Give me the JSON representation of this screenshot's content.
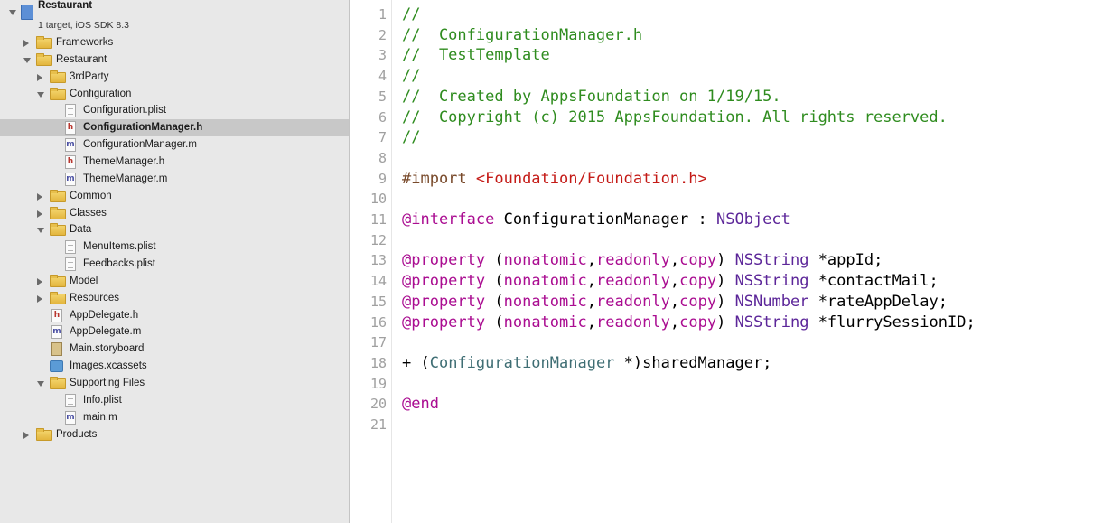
{
  "navigator": {
    "project": {
      "name": "Restaurant",
      "subtitle": "1 target, iOS SDK 8.3"
    },
    "items": [
      {
        "label": "Frameworks",
        "kind": "folder",
        "disclosure": "collapsed",
        "depth": 1
      },
      {
        "label": "Restaurant",
        "kind": "folder",
        "disclosure": "expanded",
        "depth": 1
      },
      {
        "label": "3rdParty",
        "kind": "folder",
        "disclosure": "collapsed",
        "depth": 2
      },
      {
        "label": "Configuration",
        "kind": "folder",
        "disclosure": "expanded",
        "depth": 2
      },
      {
        "label": "Configuration.plist",
        "kind": "plist",
        "depth": 3
      },
      {
        "label": "ConfigurationManager.h",
        "kind": "h",
        "depth": 3,
        "selected": true
      },
      {
        "label": "ConfigurationManager.m",
        "kind": "m",
        "depth": 3
      },
      {
        "label": "ThemeManager.h",
        "kind": "h",
        "depth": 3
      },
      {
        "label": "ThemeManager.m",
        "kind": "m",
        "depth": 3
      },
      {
        "label": "Common",
        "kind": "folder",
        "disclosure": "collapsed",
        "depth": 2
      },
      {
        "label": "Classes",
        "kind": "folder",
        "disclosure": "collapsed",
        "depth": 2
      },
      {
        "label": "Data",
        "kind": "folder",
        "disclosure": "expanded",
        "depth": 2
      },
      {
        "label": "MenuItems.plist",
        "kind": "plist",
        "depth": 3
      },
      {
        "label": "Feedbacks.plist",
        "kind": "plist",
        "depth": 3
      },
      {
        "label": "Model",
        "kind": "folder",
        "disclosure": "collapsed",
        "depth": 2
      },
      {
        "label": "Resources",
        "kind": "folder",
        "disclosure": "collapsed",
        "depth": 2
      },
      {
        "label": "AppDelegate.h",
        "kind": "h",
        "depth": 2
      },
      {
        "label": "AppDelegate.m",
        "kind": "m",
        "depth": 2
      },
      {
        "label": "Main.storyboard",
        "kind": "storyboard",
        "depth": 2
      },
      {
        "label": "Images.xcassets",
        "kind": "xcassets",
        "depth": 2
      },
      {
        "label": "Supporting Files",
        "kind": "folder",
        "disclosure": "expanded",
        "depth": 2
      },
      {
        "label": "Info.plist",
        "kind": "plist",
        "depth": 3
      },
      {
        "label": "main.m",
        "kind": "m",
        "depth": 3
      },
      {
        "label": "Products",
        "kind": "folder",
        "disclosure": "collapsed",
        "depth": 1
      }
    ]
  },
  "icons": {
    "h_glyph": "h",
    "m_glyph": "m"
  },
  "editor": {
    "lines": [
      {
        "n": "1",
        "tokens": [
          {
            "t": "//",
            "c": "comment"
          }
        ]
      },
      {
        "n": "2",
        "tokens": [
          {
            "t": "//  ConfigurationManager.h",
            "c": "comment"
          }
        ]
      },
      {
        "n": "3",
        "tokens": [
          {
            "t": "//  TestTemplate",
            "c": "comment"
          }
        ]
      },
      {
        "n": "4",
        "tokens": [
          {
            "t": "//",
            "c": "comment"
          }
        ]
      },
      {
        "n": "5",
        "tokens": [
          {
            "t": "//  Created by AppsFoundation on 1/19/15.",
            "c": "comment"
          }
        ]
      },
      {
        "n": "6",
        "tokens": [
          {
            "t": "//  Copyright (c) 2015 AppsFoundation. All rights reserved.",
            "c": "comment"
          }
        ]
      },
      {
        "n": "7",
        "tokens": [
          {
            "t": "//",
            "c": "comment"
          }
        ]
      },
      {
        "n": "8",
        "tokens": []
      },
      {
        "n": "9",
        "tokens": [
          {
            "t": "#import ",
            "c": "preproc"
          },
          {
            "t": "<Foundation/Foundation.h>",
            "c": "string"
          }
        ]
      },
      {
        "n": "10",
        "tokens": []
      },
      {
        "n": "11",
        "tokens": [
          {
            "t": "@interface",
            "c": "keyword"
          },
          {
            "t": " ConfigurationManager : ",
            "c": "plain"
          },
          {
            "t": "NSObject",
            "c": "class"
          }
        ]
      },
      {
        "n": "12",
        "tokens": []
      },
      {
        "n": "13",
        "tokens": [
          {
            "t": "@property",
            "c": "keyword"
          },
          {
            "t": " (",
            "c": "plain"
          },
          {
            "t": "nonatomic",
            "c": "keyword"
          },
          {
            "t": ",",
            "c": "plain"
          },
          {
            "t": "readonly",
            "c": "keyword"
          },
          {
            "t": ",",
            "c": "plain"
          },
          {
            "t": "copy",
            "c": "keyword"
          },
          {
            "t": ") ",
            "c": "plain"
          },
          {
            "t": "NSString",
            "c": "class"
          },
          {
            "t": " *appId;",
            "c": "plain"
          }
        ]
      },
      {
        "n": "14",
        "tokens": [
          {
            "t": "@property",
            "c": "keyword"
          },
          {
            "t": " (",
            "c": "plain"
          },
          {
            "t": "nonatomic",
            "c": "keyword"
          },
          {
            "t": ",",
            "c": "plain"
          },
          {
            "t": "readonly",
            "c": "keyword"
          },
          {
            "t": ",",
            "c": "plain"
          },
          {
            "t": "copy",
            "c": "keyword"
          },
          {
            "t": ") ",
            "c": "plain"
          },
          {
            "t": "NSString",
            "c": "class"
          },
          {
            "t": " *contactMail;",
            "c": "plain"
          }
        ]
      },
      {
        "n": "15",
        "tokens": [
          {
            "t": "@property",
            "c": "keyword"
          },
          {
            "t": " (",
            "c": "plain"
          },
          {
            "t": "nonatomic",
            "c": "keyword"
          },
          {
            "t": ",",
            "c": "plain"
          },
          {
            "t": "readonly",
            "c": "keyword"
          },
          {
            "t": ",",
            "c": "plain"
          },
          {
            "t": "copy",
            "c": "keyword"
          },
          {
            "t": ") ",
            "c": "plain"
          },
          {
            "t": "NSNumber",
            "c": "class"
          },
          {
            "t": " *rateAppDelay;",
            "c": "plain"
          }
        ]
      },
      {
        "n": "16",
        "tokens": [
          {
            "t": "@property",
            "c": "keyword"
          },
          {
            "t": " (",
            "c": "plain"
          },
          {
            "t": "nonatomic",
            "c": "keyword"
          },
          {
            "t": ",",
            "c": "plain"
          },
          {
            "t": "readonly",
            "c": "keyword"
          },
          {
            "t": ",",
            "c": "plain"
          },
          {
            "t": "copy",
            "c": "keyword"
          },
          {
            "t": ") ",
            "c": "plain"
          },
          {
            "t": "NSString",
            "c": "class"
          },
          {
            "t": " *flurrySessionID;",
            "c": "plain"
          }
        ]
      },
      {
        "n": "17",
        "tokens": []
      },
      {
        "n": "18",
        "tokens": [
          {
            "t": "+ (",
            "c": "plain"
          },
          {
            "t": "ConfigurationManager",
            "c": "project-class"
          },
          {
            "t": " *)sharedManager;",
            "c": "plain"
          }
        ]
      },
      {
        "n": "19",
        "tokens": []
      },
      {
        "n": "20",
        "tokens": [
          {
            "t": "@end",
            "c": "keyword"
          }
        ]
      },
      {
        "n": "21",
        "tokens": []
      }
    ]
  },
  "colors": {
    "comment": "#2f8c1f",
    "keyword": "#aa0d91",
    "class": "#5c2699",
    "string": "#c41a16",
    "preproc": "#78492a",
    "selection": "#c8c8c8"
  }
}
